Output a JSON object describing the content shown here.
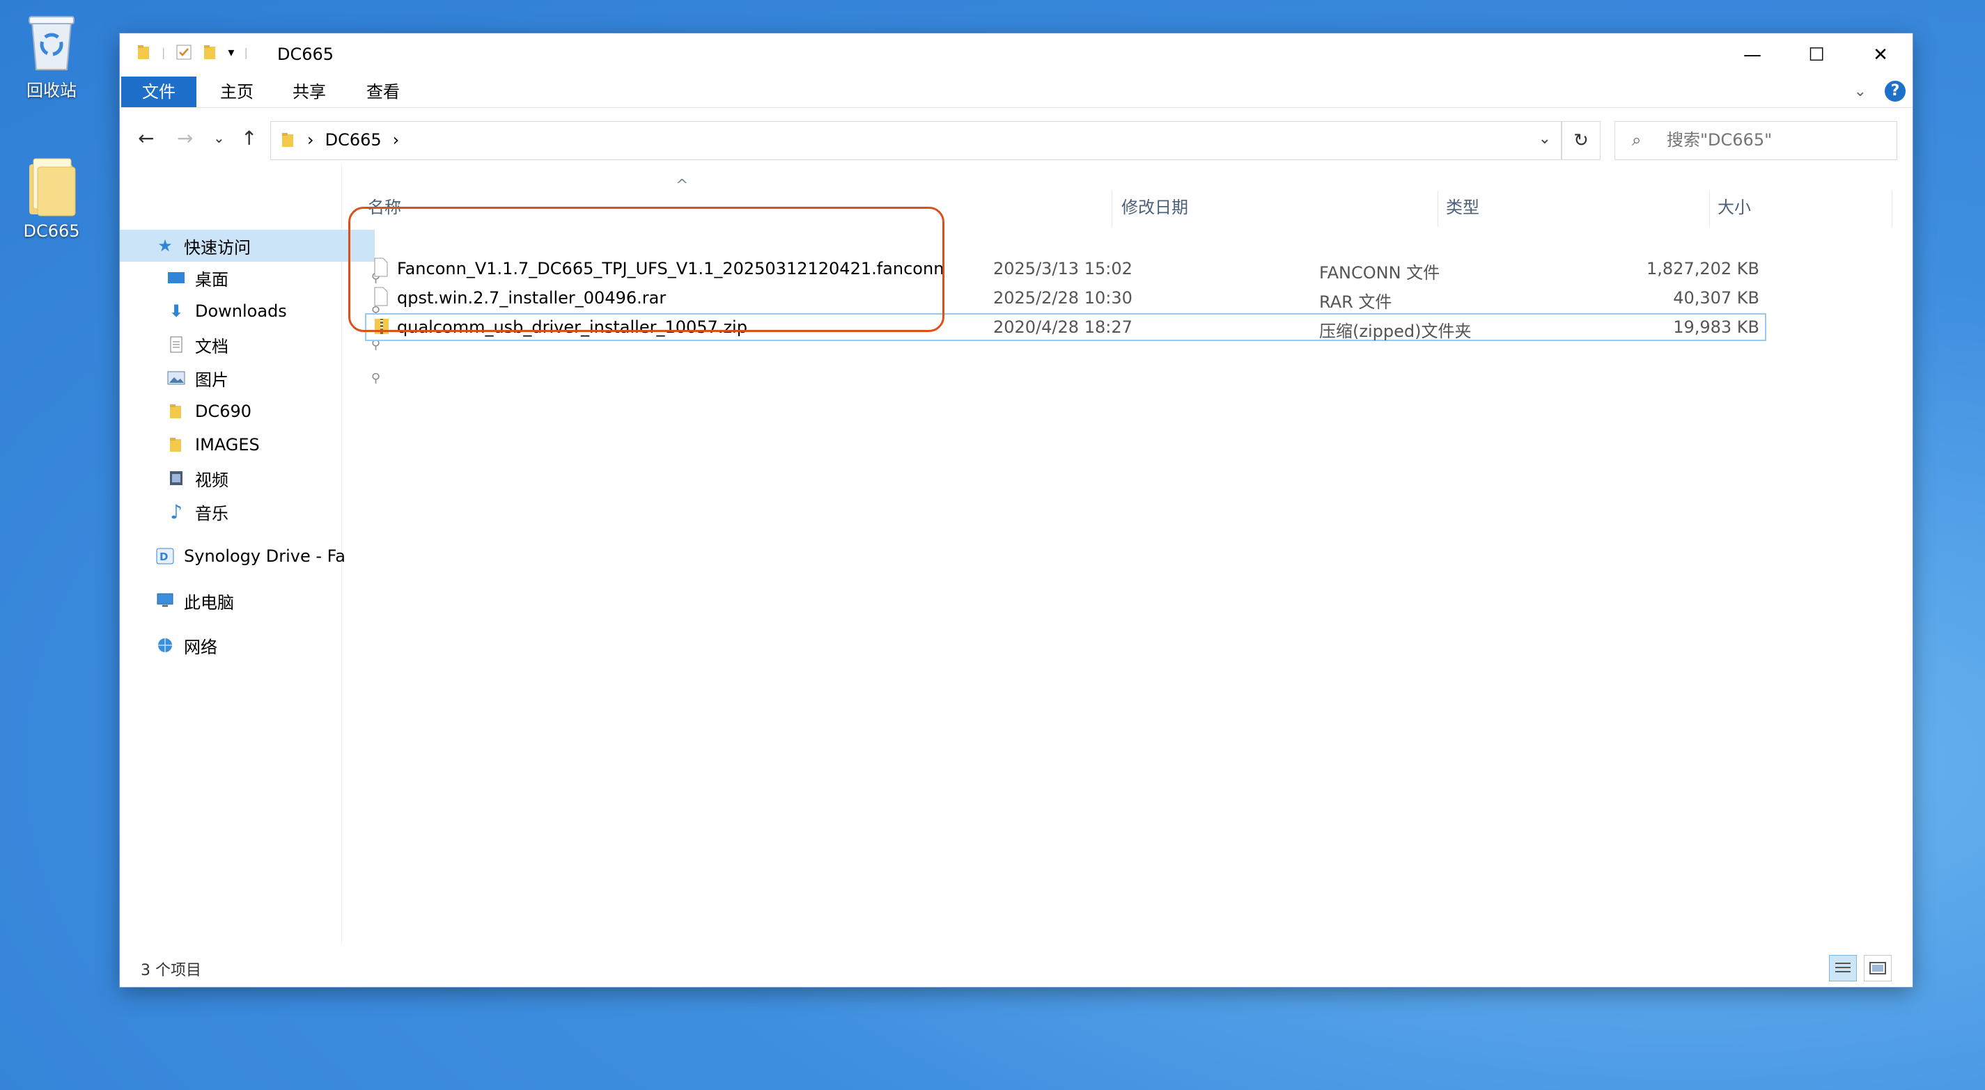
{
  "desktop": {
    "icons": [
      {
        "label": "回收站",
        "icon": "recycle-bin-icon"
      },
      {
        "label": "DC665",
        "icon": "folder-icon"
      }
    ]
  },
  "window": {
    "title": "DC665",
    "controls": {
      "minimize": "—",
      "maximize": "☐",
      "close": "✕"
    }
  },
  "ribbon": {
    "tabs": [
      "文件",
      "主页",
      "共享",
      "查看"
    ],
    "expand": "⌄",
    "help": "?"
  },
  "address": {
    "back": "←",
    "forward": "→",
    "recent": "⌄",
    "up": "↑",
    "crumb_sep": "›",
    "crumbs": [
      "DC665"
    ],
    "dropdown": "⌄",
    "refresh": "↻",
    "search_placeholder": "搜索\"DC665\""
  },
  "sidebar": {
    "quick_access": "快速访问",
    "items": [
      {
        "label": "桌面",
        "icon": "desktop-icon",
        "pinned": true
      },
      {
        "label": "Downloads",
        "icon": "downloads-icon",
        "pinned": true
      },
      {
        "label": "文档",
        "icon": "documents-icon",
        "pinned": true
      },
      {
        "label": "图片",
        "icon": "pictures-icon",
        "pinned": true
      },
      {
        "label": "DC690",
        "icon": "folder-icon",
        "pinned": false
      },
      {
        "label": "IMAGES",
        "icon": "folder-icon",
        "pinned": false
      },
      {
        "label": "视频",
        "icon": "videos-icon",
        "pinned": false
      },
      {
        "label": "音乐",
        "icon": "music-icon",
        "pinned": false
      }
    ],
    "synology": "Synology Drive - Fa",
    "this_pc": "此电脑",
    "network": "网络",
    "pin_glyph": "📌"
  },
  "columns": {
    "name": "名称",
    "date": "修改日期",
    "type": "类型",
    "size": "大小",
    "sort_indicator": "^"
  },
  "files": [
    {
      "name": "Fanconn_V1.1.7_DC665_TPJ_UFS_V1.1_20250312120421.fanconn",
      "date": "2025/3/13 15:02",
      "type": "FANCONN 文件",
      "size": "1,827,202 KB",
      "icon": "file-icon"
    },
    {
      "name": "qpst.win.2.7_installer_00496.rar",
      "date": "2025/2/28 10:30",
      "type": "RAR 文件",
      "size": "40,307 KB",
      "icon": "file-icon"
    },
    {
      "name": "qualcomm_usb_driver_installer_10057.zip",
      "date": "2020/4/28 18:27",
      "type": "压缩(zipped)文件夹",
      "size": "19,983 KB",
      "icon": "zip-folder-icon"
    }
  ],
  "status": {
    "count": "3 个项目"
  },
  "colors": {
    "accent": "#1e6fc9",
    "selection": "#cce4f7",
    "highlight_box": "#d9521c"
  }
}
